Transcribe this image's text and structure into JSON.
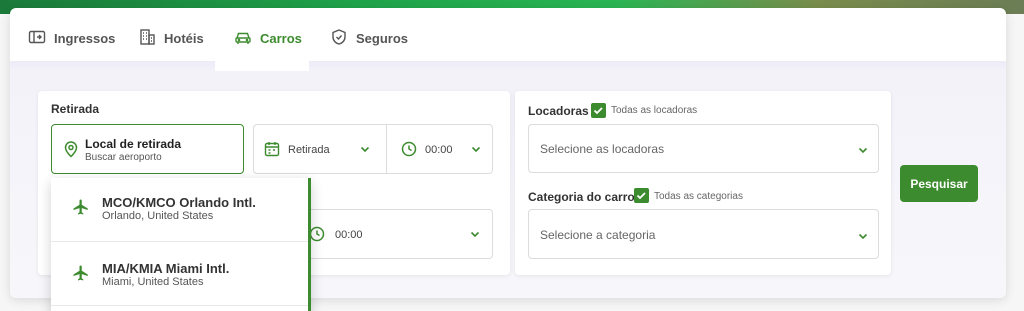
{
  "tabs": [
    {
      "label": "Ingressos",
      "icon": "ticket-icon"
    },
    {
      "label": "Hotéis",
      "icon": "building-icon"
    },
    {
      "label": "Carros",
      "icon": "car-icon"
    },
    {
      "label": "Seguros",
      "icon": "shield-icon"
    }
  ],
  "active_tab": "Carros",
  "pickup": {
    "section_label": "Retirada",
    "location_label": "Local de retirada",
    "location_placeholder": "Buscar aeroporto",
    "date_label": "Retirada",
    "time_value": "00:00"
  },
  "dropoff": {
    "time_value": "00:00"
  },
  "rental_companies": {
    "label": "Locadoras",
    "all_label": "Todas as locadoras",
    "placeholder": "Selecione as locadoras"
  },
  "car_category": {
    "label": "Categoria do carro",
    "all_label": "Todas as categorias",
    "placeholder": "Selecione a categoria"
  },
  "search_button": "Pesquisar",
  "suggestions": [
    {
      "title": "MCO/KMCO Orlando Intl.",
      "subtitle": "Orlando, United States"
    },
    {
      "title": "MIA/KMIA Miami Intl.",
      "subtitle": "Miami, United States"
    }
  ],
  "colors": {
    "accent": "#3d8b2f"
  }
}
